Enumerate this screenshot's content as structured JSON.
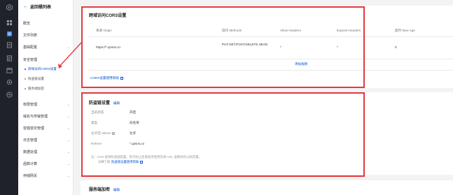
{
  "rail": {
    "icons": [
      "logo-icon",
      "grid-icon",
      "storage-icon",
      "document-icon",
      "doc-list-icon",
      "calendar-icon",
      "gear-icon",
      "monitor-icon"
    ]
  },
  "sidebar": {
    "back_label": "返回桶列表",
    "items": [
      {
        "label": "概览",
        "expandable": false
      },
      {
        "label": "文件列表",
        "expandable": false
      },
      {
        "label": "基础配置",
        "expandable": true
      },
      {
        "label": "安全管理",
        "expandable": true
      }
    ],
    "sub_items": [
      {
        "label": "跨域访问CORS设置",
        "active": true
      },
      {
        "label": "防盗链设置",
        "active": false
      },
      {
        "label": "服务端加密",
        "active": false
      }
    ],
    "items_after": [
      {
        "label": "权限管理"
      },
      {
        "label": "域名与传输管理"
      },
      {
        "label": "容错容灾管理"
      },
      {
        "label": "日志管理"
      },
      {
        "label": "数据处理"
      },
      {
        "label": "函数计算"
      },
      {
        "label": "存储网关"
      }
    ]
  },
  "cors": {
    "title": "跨域访问CORS设置",
    "columns": [
      "来源 Origin",
      "操作 Methods",
      "Allow-Headers",
      "Expose-Headers",
      "超时 Max-Age"
    ],
    "rows": [
      {
        "origin": "https://*.qzsns.cn",
        "methods": "PUT,GET,POST,DELETE,HEAD",
        "allow_headers": "*",
        "expose_headers": "*",
        "max_age": "0"
      }
    ],
    "add_rule": "添加规则",
    "help_link": "CORS设置使用帮助"
  },
  "hotlink": {
    "title": "防盗链设置",
    "edit": "编辑",
    "fields": [
      {
        "label": "当前状态",
        "value": "开启"
      },
      {
        "label": "类型",
        "value": "白名单"
      },
      {
        "label": "允许空 referer",
        "value": "允许"
      },
      {
        "label": "Referer",
        "value": "*.qzsns.cn"
      }
    ],
    "note_line1": "注：COS 提供防盗链配置，用于防止恶意程序使用资源 URL 盗刷你的公网流量。",
    "note_prefix": "详细了解",
    "note_link": "防盗链设置使用帮助"
  },
  "encryption": {
    "title": "服务端加密",
    "edit": "编辑"
  },
  "colors": {
    "accent": "#0052d9",
    "highlight": "#e4393c",
    "rail_bg": "#1f2229"
  }
}
